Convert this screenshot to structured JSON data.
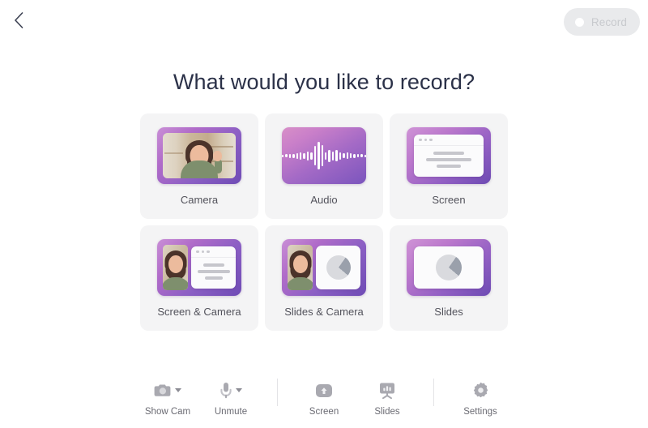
{
  "topbar": {
    "back_label": "Back",
    "back_icon": "chevron-left-icon",
    "record": {
      "label": "Record",
      "dot_icon": "record-dot-icon",
      "enabled": false,
      "bg_color": "#e9eaec",
      "text_color": "#c8cace"
    }
  },
  "heading": {
    "title": "What would you like to record?",
    "color": "#2b3148"
  },
  "cards": [
    {
      "id": "camera",
      "label": "Camera",
      "thumb": "camera-thumbnail"
    },
    {
      "id": "audio",
      "label": "Audio",
      "thumb": "audio-waveform-thumbnail"
    },
    {
      "id": "screen",
      "label": "Screen",
      "thumb": "screen-window-thumbnail"
    },
    {
      "id": "screen-camera",
      "label": "Screen & Camera",
      "thumb": "screen-and-camera-thumbnail"
    },
    {
      "id": "slides-camera",
      "label": "Slides & Camera",
      "thumb": "slides-and-camera-thumbnail"
    },
    {
      "id": "slides",
      "label": "Slides",
      "thumb": "slides-thumbnail"
    }
  ],
  "toolbar": {
    "items": [
      {
        "id": "show-cam",
        "label": "Show Cam",
        "icon": "camera-icon",
        "has_caret": true
      },
      {
        "id": "unmute",
        "label": "Unmute",
        "icon": "microphone-icon",
        "has_caret": true
      },
      {
        "id": "screen",
        "label": "Screen",
        "icon": "screen-share-icon",
        "has_caret": false
      },
      {
        "id": "slides",
        "label": "Slides",
        "icon": "presentation-icon",
        "has_caret": false
      },
      {
        "id": "settings",
        "label": "Settings",
        "icon": "gear-icon",
        "has_caret": false
      }
    ],
    "label_color": "#6b6b73",
    "icon_color": "#a9a9b0"
  },
  "theme": {
    "page_bg": "#ffffff",
    "card_bg": "#f4f4f5",
    "accent_purple": "#8b5fc4",
    "accent_pink": "#cf93d6"
  }
}
